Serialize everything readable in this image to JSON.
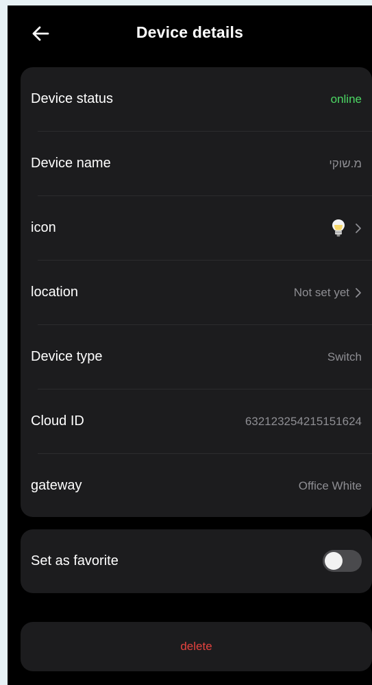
{
  "header": {
    "title": "Device details",
    "back_icon": "arrow-left-icon"
  },
  "details": {
    "rows": [
      {
        "label": "Device status",
        "value": "online"
      },
      {
        "label": "Device name",
        "value": "מ.שוקי"
      },
      {
        "label": "icon",
        "icon": "light-bulb-icon"
      },
      {
        "label": "location",
        "value": "Not set yet"
      },
      {
        "label": "Device type",
        "value": "Switch"
      },
      {
        "label": "Cloud ID",
        "value": "632123254215151624"
      },
      {
        "label": "gateway",
        "value": "Office White"
      }
    ]
  },
  "favorite": {
    "label": "Set as favorite",
    "enabled": false
  },
  "delete": {
    "label": "delete"
  },
  "colors": {
    "background": "#000000",
    "card": "#1c1c1e",
    "status_online": "#4cd964",
    "delete": "#e5433f",
    "secondary_text": "#8e8e93"
  }
}
